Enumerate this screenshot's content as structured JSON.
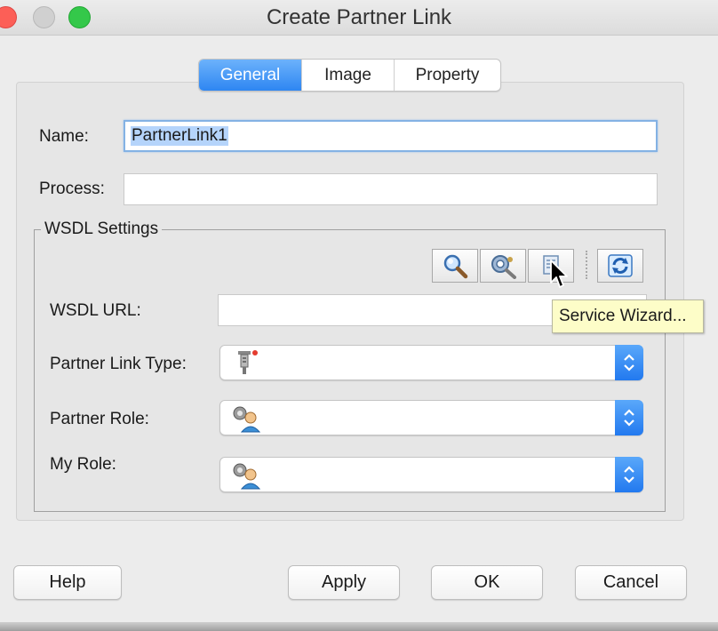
{
  "window": {
    "title": "Create Partner Link"
  },
  "tabs": [
    {
      "label": "General",
      "active": true
    },
    {
      "label": "Image",
      "active": false
    },
    {
      "label": "Property",
      "active": false
    }
  ],
  "form": {
    "name_label": "Name:",
    "name_value": "PartnerLink1",
    "process_label": "Process:",
    "process_value": ""
  },
  "wsdl": {
    "group_title": "WSDL Settings",
    "url_label": "WSDL URL:",
    "url_value": "",
    "toolbar_icons": [
      "search-icon",
      "browse-services-icon",
      "service-wizard-icon",
      "refresh-icon"
    ],
    "tooltip": "Service Wizard...",
    "partner_link_type_label": "Partner Link Type:",
    "partner_role_label": "Partner Role:",
    "my_role_label": "My Role:"
  },
  "buttons": {
    "help": "Help",
    "apply": "Apply",
    "ok": "OK",
    "cancel": "Cancel"
  },
  "colors": {
    "accent": "#2e86f2",
    "tooltip_bg": "#fdfdc8",
    "selection": "#b5d4fb"
  }
}
